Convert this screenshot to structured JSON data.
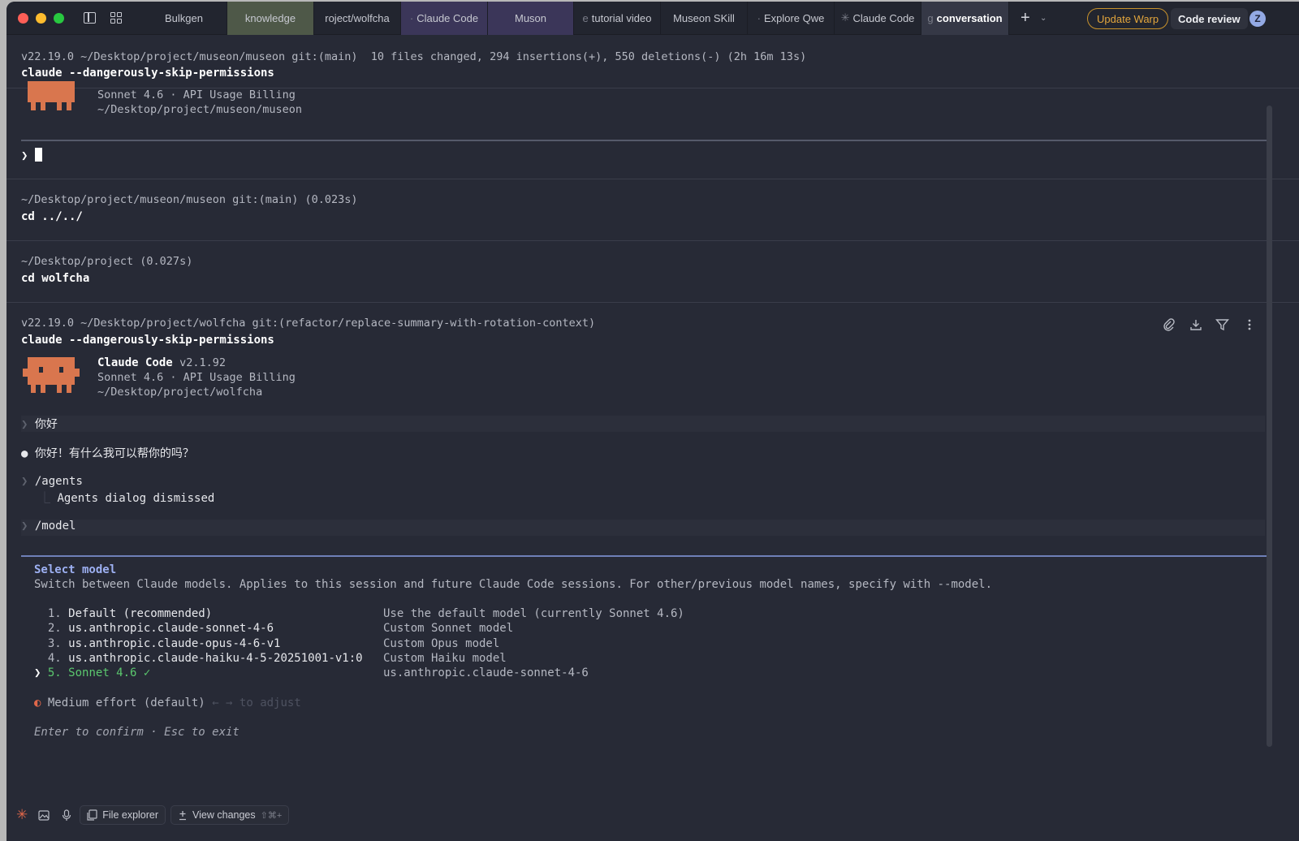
{
  "tabs": [
    {
      "label": "Bulkgen",
      "style": "plain",
      "prefix": ""
    },
    {
      "label": "knowledge",
      "style": "k",
      "prefix": ""
    },
    {
      "label": "roject/wolfcha",
      "style": "plain",
      "prefix": ""
    },
    {
      "label": "Claude Code",
      "style": "p",
      "prefix": "·"
    },
    {
      "label": "Muson",
      "style": "p",
      "prefix": ""
    },
    {
      "label": "tutorial video",
      "style": "plain",
      "prefix": "e"
    },
    {
      "label": "Museon SKill",
      "style": "plain",
      "prefix": ""
    },
    {
      "label": "Explore Qwe",
      "style": "plain",
      "prefix": "·"
    },
    {
      "label": "Claude Code",
      "style": "plain",
      "prefix": "✳"
    },
    {
      "label": "conversation",
      "style": "active",
      "prefix": "g"
    }
  ],
  "header": {
    "update_label": "Update Warp",
    "review_label": "Code review",
    "avatar_initial": "Z",
    "plus": "+",
    "caret": "⌄"
  },
  "blocks": {
    "b1": {
      "meta": "v22.19.0 ~/Desktop/project/museon/museon git:(main)  10 files changed, 294 insertions(+), 550 deletions(-) (2h 16m 13s)",
      "cmd": "claude --dangerously-skip-permissions",
      "info1": "Sonnet 4.6 · API Usage Billing",
      "info2": "~/Desktop/project/museon/museon",
      "prompt": "❯",
      "cursor_char": "%"
    },
    "b2": {
      "meta": "~/Desktop/project/museon/museon git:(main) (0.023s)",
      "cmd": "cd ../../"
    },
    "b3": {
      "meta": "~/Desktop/project (0.027s)",
      "cmd": "cd wolfcha"
    },
    "b4": {
      "meta": "v22.19.0 ~/Desktop/project/wolfcha git:(refactor/replace-summary-with-rotation-context)",
      "cmd": "claude --dangerously-skip-permissions",
      "app_name": "Claude Code",
      "version": "v2.1.92",
      "info1": "Sonnet 4.6 · API Usage Billing",
      "info2": "~/Desktop/project/wolfcha",
      "user_msg1": "你好",
      "reply1": "你好！有什么我可以帮你的吗？",
      "user_msg2": "/agents",
      "agents_result": "Agents dialog dismissed",
      "user_msg3": "/model",
      "chevron": "❯",
      "bullet": "●",
      "tree": "⎿"
    }
  },
  "model_select": {
    "title": "Select model",
    "subtitle": "Switch between Claude models. Applies to this session and future Claude Code sessions. For other/previous model names, specify with --model.",
    "options": [
      {
        "num": "1.",
        "name": "Default (recommended)",
        "desc": "Use the default model (currently Sonnet 4.6)"
      },
      {
        "num": "2.",
        "name": "us.anthropic.claude-sonnet-4-6",
        "desc": "Custom Sonnet model"
      },
      {
        "num": "3.",
        "name": "us.anthropic.claude-opus-4-6-v1",
        "desc": "Custom Opus model"
      },
      {
        "num": "4.",
        "name": "us.anthropic.claude-haiku-4-5-20251001-v1:0",
        "desc": "Custom Haiku model"
      },
      {
        "num": "5.",
        "name": "Sonnet 4.6 ✓",
        "desc": "us.anthropic.claude-sonnet-4-6"
      }
    ],
    "selected_chevron": "❯",
    "effort_icon": "◐",
    "effort": "Medium effort (default)",
    "effort_hint": "← → to adjust",
    "footer": "Enter to confirm · Esc to exit"
  },
  "bottom": {
    "file_explorer": "File explorer",
    "view_changes": "View changes",
    "view_changes_kbd": "⇧⌘+"
  },
  "colors": {
    "background": "#272a36",
    "accent_orange": "#d9764e",
    "selected_green": "#5bc86e",
    "title_blue": "#9db0f2",
    "update_orange": "#e3a63c"
  }
}
